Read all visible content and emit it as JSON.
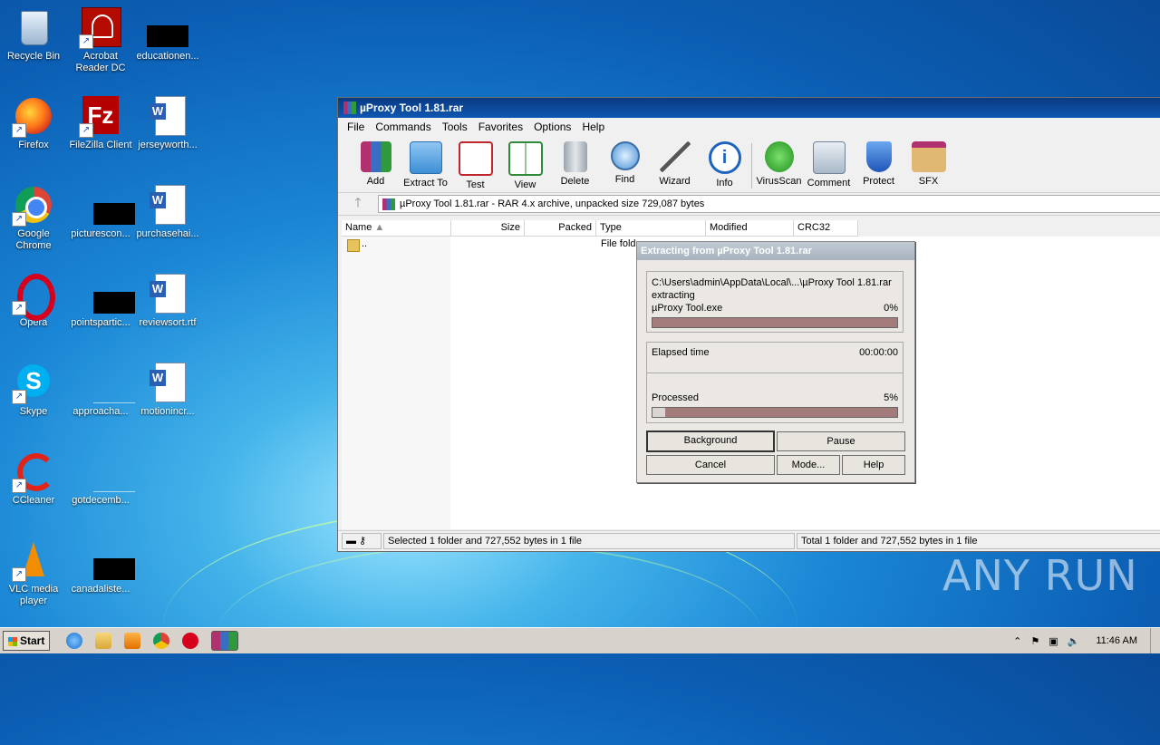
{
  "desktop": {
    "icons": [
      {
        "label": "Recycle Bin",
        "icon": "recycle-bin-icon"
      },
      {
        "label": "Acrobat Reader DC",
        "icon": "acrobat-icon"
      },
      {
        "label": "educationen...",
        "icon": "redacted-file-icon"
      },
      {
        "label": "Firefox",
        "icon": "firefox-icon"
      },
      {
        "label": "FileZilla Client",
        "icon": "filezilla-icon"
      },
      {
        "label": "jerseyworth...",
        "icon": "word-doc-icon"
      },
      {
        "label": "Google Chrome",
        "icon": "chrome-icon"
      },
      {
        "label": "picturescon...",
        "icon": "redacted-file-icon"
      },
      {
        "label": "purchasehai...",
        "icon": "word-doc-icon"
      },
      {
        "label": "Opera",
        "icon": "opera-icon"
      },
      {
        "label": "pointspartic...",
        "icon": "redacted-file-icon"
      },
      {
        "label": "reviewsort.rtf",
        "icon": "word-doc-icon"
      },
      {
        "label": "Skype",
        "icon": "skype-icon"
      },
      {
        "label": "approacha...",
        "icon": "blank-file-icon"
      },
      {
        "label": "motionincr...",
        "icon": "word-doc-icon"
      },
      {
        "label": "CCleaner",
        "icon": "ccleaner-icon"
      },
      {
        "label": "gotdecemb...",
        "icon": "blank-file-icon"
      },
      {
        "label": "VLC media player",
        "icon": "vlc-icon"
      },
      {
        "label": "canadaliste...",
        "icon": "redacted-file-icon"
      }
    ],
    "watermark": "ANY RUN"
  },
  "window": {
    "title": "µProxy Tool 1.81.rar",
    "menu": [
      "File",
      "Commands",
      "Tools",
      "Favorites",
      "Options",
      "Help"
    ],
    "toolbar": [
      {
        "label": "Add",
        "icon": "add-icon"
      },
      {
        "label": "Extract To",
        "icon": "extract-to-icon"
      },
      {
        "label": "Test",
        "icon": "test-icon"
      },
      {
        "label": "View",
        "icon": "view-icon"
      },
      {
        "label": "Delete",
        "icon": "delete-icon"
      },
      {
        "label": "Find",
        "icon": "find-icon"
      },
      {
        "label": "Wizard",
        "icon": "wizard-icon"
      },
      {
        "label": "Info",
        "icon": "info-icon"
      },
      {
        "label": "VirusScan",
        "icon": "virusscan-icon"
      },
      {
        "label": "Comment",
        "icon": "comment-icon"
      },
      {
        "label": "Protect",
        "icon": "protect-icon"
      },
      {
        "label": "SFX",
        "icon": "sfx-icon"
      }
    ],
    "path": "µProxy Tool 1.81.rar - RAR 4.x archive, unpacked size 729,087 bytes",
    "columns": [
      "Name",
      "Size",
      "Packed",
      "Type",
      "Modified",
      "CRC32"
    ],
    "rows": [
      {
        "name": "..",
        "type": "File fold"
      }
    ],
    "status_left": "Selected 1 folder and 727,552 bytes in 1 file",
    "status_right": "Total 1 folder and 727,552 bytes in 1 file"
  },
  "dialog": {
    "title": "Extracting from µProxy Tool 1.81.rar",
    "path": "C:\\Users\\admin\\AppData\\Local\\...\\µProxy Tool 1.81.rar",
    "action": "extracting",
    "file": "µProxy Tool.exe",
    "file_percent": "0%",
    "file_progress": 0,
    "elapsed_label": "Elapsed time",
    "elapsed_value": "00:00:00",
    "processed_label": "Processed",
    "processed_percent": "5%",
    "processed_progress": 0.05,
    "buttons": {
      "background": "Background",
      "pause": "Pause",
      "cancel": "Cancel",
      "mode": "Mode...",
      "help": "Help"
    }
  },
  "taskbar": {
    "start": "Start",
    "clock": "11:46 AM"
  }
}
